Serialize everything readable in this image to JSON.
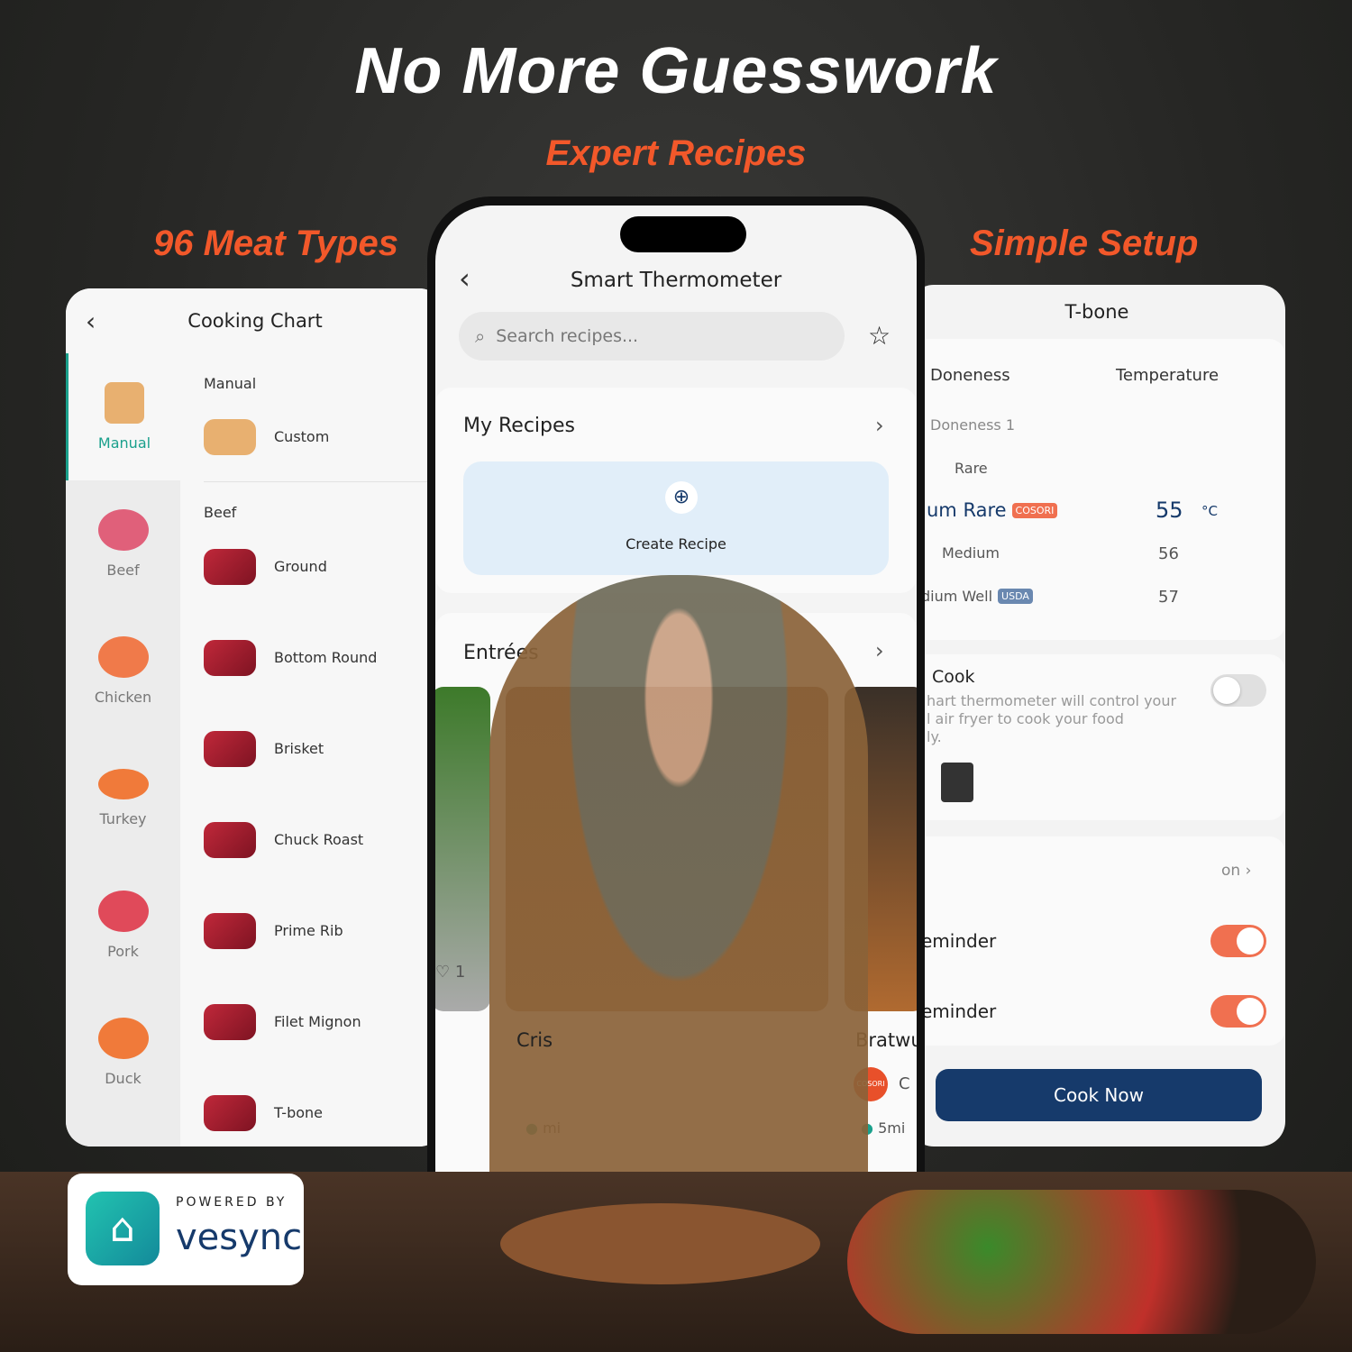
{
  "headline": "No More Guesswork",
  "taglines": {
    "center": "Expert Recipes",
    "left": "96 Meat Types",
    "right": "Simple Setup"
  },
  "colors": {
    "accent": "#f2582a",
    "teal": "#1aa08c",
    "navy": "#163a6b",
    "toggle_on": "#f07050"
  },
  "cooking_chart": {
    "title": "Cooking Chart",
    "back_icon": "chevron-left-icon",
    "categories": [
      {
        "label": "Manual",
        "active": true
      },
      {
        "label": "Beef"
      },
      {
        "label": "Chicken"
      },
      {
        "label": "Turkey"
      },
      {
        "label": "Pork"
      },
      {
        "label": "Duck"
      }
    ],
    "sections": [
      {
        "title": "Manual",
        "items": [
          "Custom"
        ]
      },
      {
        "title": "Beef",
        "items": [
          "Ground",
          "Bottom Round",
          "Brisket",
          "Chuck Roast",
          "Prime Rib",
          "Filet Mignon",
          "T-bone"
        ]
      }
    ]
  },
  "app": {
    "title": "Smart Thermometer",
    "search_placeholder": "Search recipes...",
    "favorite_icon": "star-icon",
    "my_recipes": "My Recipes",
    "create_recipe": "Create Recipe",
    "entrees": "Entrées",
    "recipe_cards": [
      {
        "title": "Cris",
        "time": "mi",
        "likes": "1"
      },
      {
        "title": "Bratwu",
        "brand": "COSORI",
        "author": "C",
        "time": "5mi"
      }
    ]
  },
  "tbone": {
    "title": "T-bone",
    "col_doneness": "Doneness",
    "col_temp": "Temperature",
    "group": "Doneness 1",
    "rows": [
      {
        "name": "Rare",
        "temp": ""
      },
      {
        "name": "um Rare",
        "badge": "COSORI",
        "temp": "55",
        "unit": "°C",
        "selected": true
      },
      {
        "name": "Medium",
        "temp": "56"
      },
      {
        "name": "dium Well",
        "badge": "USDA",
        "temp": "57"
      }
    ],
    "cook_title": "Cook",
    "cook_desc": [
      "hart thermometer will control your",
      "l air fryer to cook your food",
      "ly."
    ],
    "cook_toggle": false,
    "option_value": "on",
    "reminder1": "eminder",
    "reminder1_on": true,
    "reminder2": "eminder",
    "reminder2_on": true,
    "cook_now": "Cook Now"
  },
  "badge": {
    "powered_by": "POWERED BY",
    "brand": "vesync"
  }
}
